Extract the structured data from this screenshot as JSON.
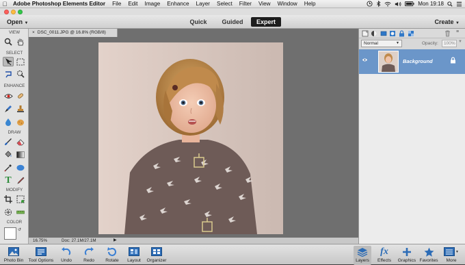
{
  "menubar": {
    "app_name": "Adobe Photoshop Elements Editor",
    "items": [
      "File",
      "Edit",
      "Image",
      "Enhance",
      "Layer",
      "Select",
      "Filter",
      "View",
      "Window",
      "Help"
    ],
    "clock": "Mon 19:18"
  },
  "modebar": {
    "open_label": "Open",
    "modes": [
      "Quick",
      "Guided",
      "Expert"
    ],
    "active_mode": "Expert",
    "create_label": "Create"
  },
  "toolbox": {
    "sections": [
      "VIEW",
      "SELECT",
      "ENHANCE",
      "DRAW",
      "MODIFY",
      "COLOR"
    ],
    "tools": {
      "zoom": "zoom-icon",
      "hand": "hand-icon",
      "move": "move-icon",
      "marquee": "marquee-icon",
      "lasso": "lasso-icon",
      "quick_select": "quick-selection-icon",
      "red_eye": "red-eye-icon",
      "spot_heal": "spot-healing-icon",
      "smart_brush": "smart-brush-icon",
      "clone": "clone-stamp-icon",
      "blur": "blur-icon",
      "sponge": "sponge-icon",
      "brush": "brush-icon",
      "eraser": "eraser-icon",
      "paint_bucket": "paint-bucket-icon",
      "gradient": "gradient-icon",
      "eyedropper": "eyedropper-icon",
      "shape": "ellipse-shape-icon",
      "type": "type-icon",
      "pencil": "pencil-icon",
      "crop": "crop-icon",
      "recompose": "recompose-icon",
      "content_move": "content-aware-move-icon",
      "straighten": "straighten-icon"
    }
  },
  "document": {
    "tab_title": "DSC_0011.JPG @ 16.8% (RGB/8)",
    "zoom": "16.75%",
    "doc_info": "Doc: 27.1M/27.1M"
  },
  "layers_panel": {
    "blend_mode": "Normal",
    "opacity_label": "Opacity:",
    "opacity_value": "100%",
    "layers": [
      {
        "name": "Background"
      }
    ]
  },
  "bottombar": {
    "left": [
      {
        "label": "Photo Bin",
        "icon": "photo-bin-icon"
      },
      {
        "label": "Tool Options",
        "icon": "tool-options-icon"
      },
      {
        "label": "Undo",
        "icon": "undo-icon"
      },
      {
        "label": "Redo",
        "icon": "redo-icon"
      },
      {
        "label": "Rotate",
        "icon": "rotate-icon"
      },
      {
        "label": "Layout",
        "icon": "layout-icon"
      },
      {
        "label": "Organizer",
        "icon": "organizer-icon"
      }
    ],
    "right": [
      {
        "label": "Layers",
        "icon": "layers-icon"
      },
      {
        "label": "Effects",
        "icon": "effects-icon"
      },
      {
        "label": "Graphics",
        "icon": "graphics-icon"
      },
      {
        "label": "Favorites",
        "icon": "favorites-icon"
      },
      {
        "label": "More",
        "icon": "more-icon"
      }
    ]
  },
  "colors": {
    "accent_blue": "#6b96c9",
    "expert_bg": "#1d1d1d",
    "photo_bg": "#d9c7bf"
  }
}
